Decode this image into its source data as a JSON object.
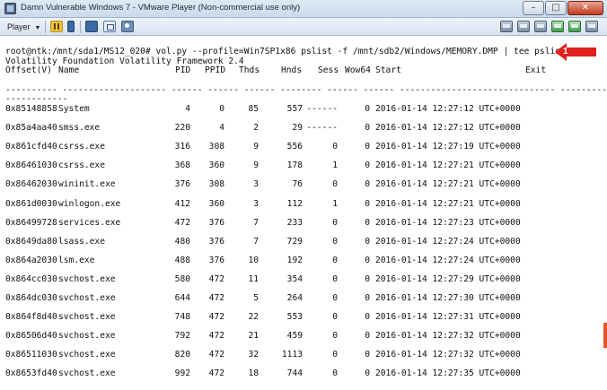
{
  "window": {
    "title": "Damn Vulnerable Windows 7 - VMware Player (Non-commercial use only)",
    "minimize": "–",
    "maximize": "□",
    "close": "✕"
  },
  "toolbar": {
    "player_label": "Player",
    "player_caret": "▼",
    "icons": [
      "pause-icon",
      "device-icon",
      "fullscreen-icon",
      "unity-icon"
    ],
    "device_icons": [
      "hdd-icon",
      "network-icon",
      "network-icon-2",
      "usb-icon",
      "sound-icon",
      "printer-icon"
    ]
  },
  "terminal": {
    "command": "root@ntk:/mnt/sda1/MS12_020# vol.py --profile=Win7SP1x86 pslist -f /mnt/sdb2/Windows/MEMORY.DMP | tee pslist.txt",
    "banner": "Volatility Foundation Volatility Framework 2.4",
    "headers": [
      "Offset(V)",
      "Name",
      "PID",
      "PPID",
      "Thds",
      "Hnds",
      "Sess",
      "Wow64",
      "Start",
      "Exit"
    ],
    "separator_line": "---------- -------------------- ------ ------ ------ -------- ------ ------ ------------------------------ ----------------",
    "separator_tail": "------------",
    "rows": [
      {
        "offset": "0x85148858",
        "name": "System",
        "pid": "4",
        "ppid": "0",
        "thds": "85",
        "hnds": "557",
        "sess": "------",
        "wow64": "0",
        "start": "2016-01-14 12:27:12 UTC+0000"
      },
      {
        "offset": "0x85a4aa40",
        "name": "smss.exe",
        "pid": "220",
        "ppid": "4",
        "thds": "2",
        "hnds": "29",
        "sess": "------",
        "wow64": "0",
        "start": "2016-01-14 12:27:12 UTC+0000"
      },
      {
        "offset": "0x861cfd40",
        "name": "csrss.exe",
        "pid": "316",
        "ppid": "308",
        "thds": "9",
        "hnds": "556",
        "sess": "0",
        "wow64": "0",
        "start": "2016-01-14 12:27:19 UTC+0000"
      },
      {
        "offset": "0x86461030",
        "name": "csrss.exe",
        "pid": "368",
        "ppid": "360",
        "thds": "9",
        "hnds": "178",
        "sess": "1",
        "wow64": "0",
        "start": "2016-01-14 12:27:21 UTC+0000"
      },
      {
        "offset": "0x86462030",
        "name": "wininit.exe",
        "pid": "376",
        "ppid": "308",
        "thds": "3",
        "hnds": "76",
        "sess": "0",
        "wow64": "0",
        "start": "2016-01-14 12:27:21 UTC+0000"
      },
      {
        "offset": "0x861d0030",
        "name": "winlogon.exe",
        "pid": "412",
        "ppid": "360",
        "thds": "3",
        "hnds": "112",
        "sess": "1",
        "wow64": "0",
        "start": "2016-01-14 12:27:21 UTC+0000"
      },
      {
        "offset": "0x86499728",
        "name": "services.exe",
        "pid": "472",
        "ppid": "376",
        "thds": "7",
        "hnds": "233",
        "sess": "0",
        "wow64": "0",
        "start": "2016-01-14 12:27:23 UTC+0000"
      },
      {
        "offset": "0x8649da80",
        "name": "lsass.exe",
        "pid": "480",
        "ppid": "376",
        "thds": "7",
        "hnds": "729",
        "sess": "0",
        "wow64": "0",
        "start": "2016-01-14 12:27:24 UTC+0000"
      },
      {
        "offset": "0x864a2030",
        "name": "lsm.exe",
        "pid": "488",
        "ppid": "376",
        "thds": "10",
        "hnds": "192",
        "sess": "0",
        "wow64": "0",
        "start": "2016-01-14 12:27:24 UTC+0000"
      },
      {
        "offset": "0x864cc030",
        "name": "svchost.exe",
        "pid": "580",
        "ppid": "472",
        "thds": "11",
        "hnds": "354",
        "sess": "0",
        "wow64": "0",
        "start": "2016-01-14 12:27:29 UTC+0000"
      },
      {
        "offset": "0x864dc030",
        "name": "svchost.exe",
        "pid": "644",
        "ppid": "472",
        "thds": "5",
        "hnds": "264",
        "sess": "0",
        "wow64": "0",
        "start": "2016-01-14 12:27:30 UTC+0000"
      },
      {
        "offset": "0x864f8d40",
        "name": "svchost.exe",
        "pid": "748",
        "ppid": "472",
        "thds": "22",
        "hnds": "553",
        "sess": "0",
        "wow64": "0",
        "start": "2016-01-14 12:27:31 UTC+0000"
      },
      {
        "offset": "0x86506d40",
        "name": "svchost.exe",
        "pid": "792",
        "ppid": "472",
        "thds": "21",
        "hnds": "459",
        "sess": "0",
        "wow64": "0",
        "start": "2016-01-14 12:27:32 UTC+0000"
      },
      {
        "offset": "0x86511030",
        "name": "svchost.exe",
        "pid": "820",
        "ppid": "472",
        "thds": "32",
        "hnds": "1113",
        "sess": "0",
        "wow64": "0",
        "start": "2016-01-14 12:27:32 UTC+0000"
      },
      {
        "offset": "0x8653fd40",
        "name": "svchost.exe",
        "pid": "992",
        "ppid": "472",
        "thds": "18",
        "hnds": "744",
        "sess": "0",
        "wow64": "0",
        "start": "2016-01-14 12:27:35 UTC+0000"
      }
    ]
  },
  "annotation": {
    "number": "1",
    "color": "#e0201b"
  }
}
